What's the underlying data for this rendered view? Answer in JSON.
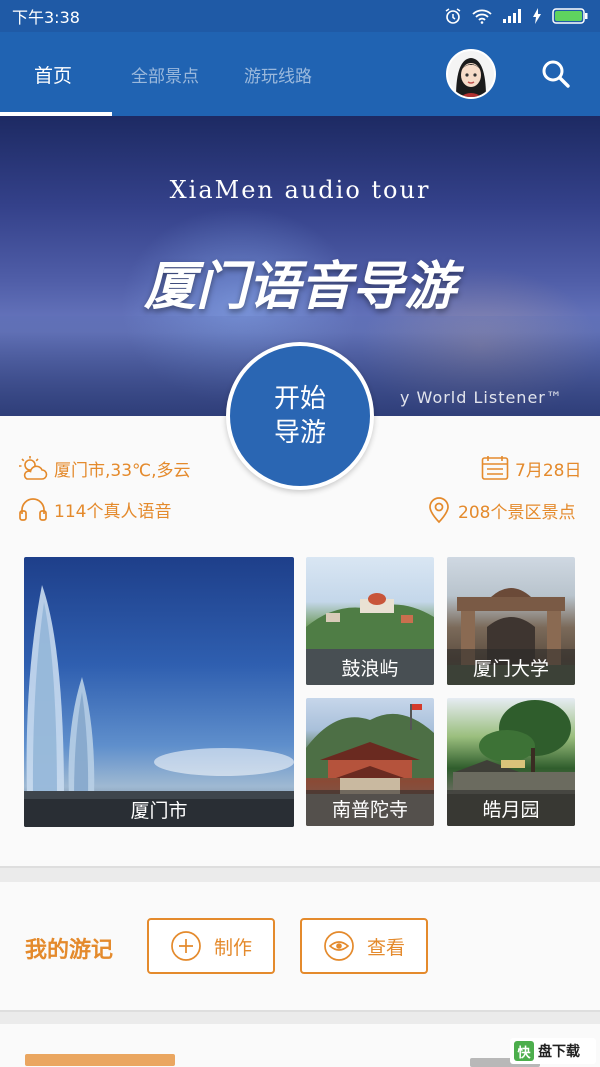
{
  "status_bar": {
    "time": "下午3:38"
  },
  "nav": {
    "tabs": [
      {
        "label": "首页",
        "active": true
      },
      {
        "label": "全部景点",
        "active": false
      },
      {
        "label": "游玩线路",
        "active": false
      }
    ],
    "icons": {
      "avatar": "user-avatar",
      "search": "search-icon"
    }
  },
  "banner": {
    "title_en": "XiaMen audio tour",
    "title_cn": "厦门语音导游",
    "subtitle": "y World Listener™"
  },
  "start_button": {
    "line1": "开始",
    "line2": "导游"
  },
  "info": {
    "weather": "厦门市,33℃,多云",
    "date": "7月28日",
    "voices": "114个真人语音",
    "spots": "208个景区景点"
  },
  "attractions": [
    {
      "name": "厦门市"
    },
    {
      "name": "鼓浪屿"
    },
    {
      "name": "厦门大学"
    },
    {
      "name": "南普陀寺"
    },
    {
      "name": "皓月园"
    }
  ],
  "my_travels": {
    "title": "我的游记",
    "create_label": "制作",
    "view_label": "查看"
  },
  "watermark": {
    "logo": "快",
    "text": "盘下载"
  },
  "colors": {
    "primary": "#2063b2",
    "accent": "#e48a2c",
    "background": "#ebebeb"
  }
}
